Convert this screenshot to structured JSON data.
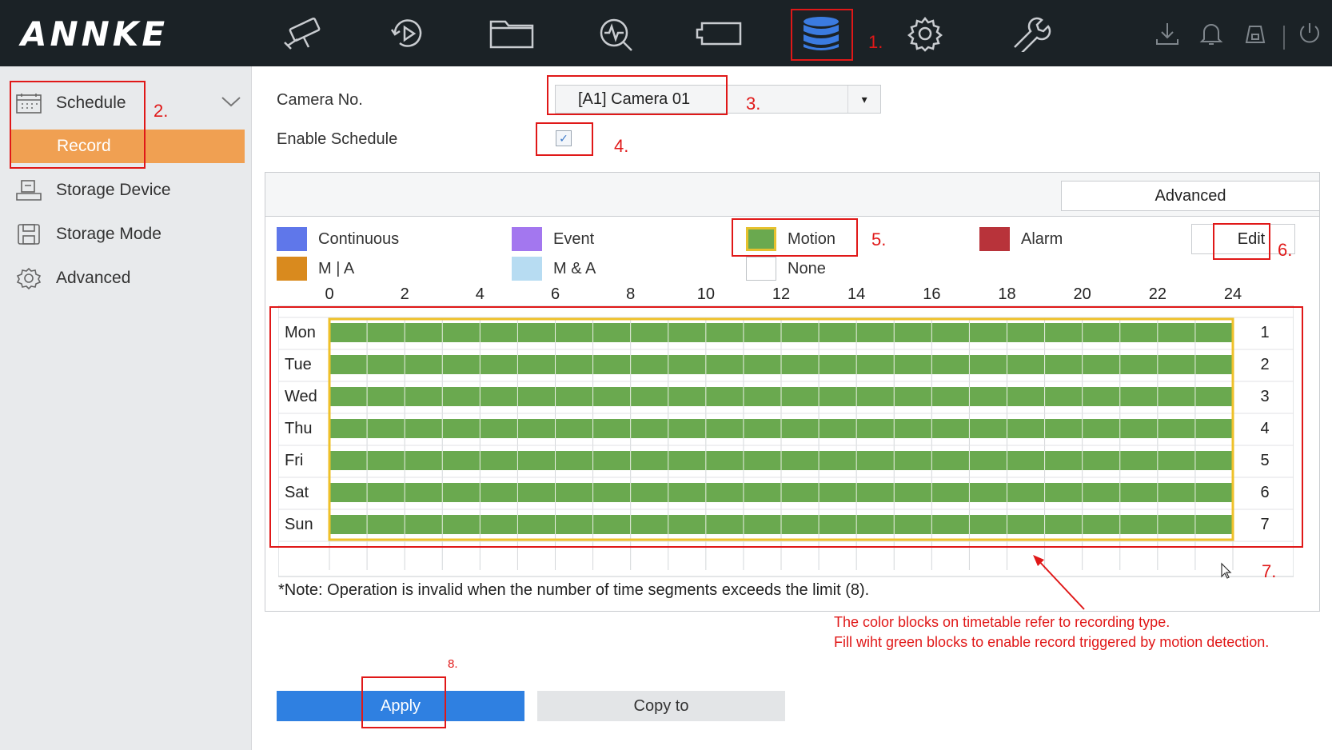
{
  "app": {
    "logo": "ANNKE"
  },
  "topnav": {
    "items": [
      {
        "name": "live-view-camera-icon"
      },
      {
        "name": "playback-icon"
      },
      {
        "name": "file-folder-icon"
      },
      {
        "name": "smart-analysis-icon"
      },
      {
        "name": "camera-management-icon"
      },
      {
        "name": "storage-database-icon",
        "active": true
      },
      {
        "name": "configuration-gear-icon"
      },
      {
        "name": "maintenance-wrench-icon"
      }
    ],
    "system_icons": [
      "download-icon",
      "bell-icon",
      "lock-icon",
      "power-icon"
    ],
    "active_color": "#3b7be0"
  },
  "sidebar": {
    "schedule": "Schedule",
    "record": "Record",
    "storage_device": "Storage Device",
    "storage_mode": "Storage Mode",
    "advanced": "Advanced"
  },
  "form": {
    "camera_label": "Camera No.",
    "camera_value": "[A1] Camera 01",
    "enable_label": "Enable Schedule",
    "enable_checked": true
  },
  "panel": {
    "advanced_button": "Advanced",
    "edit_button": "Edit"
  },
  "legend": [
    {
      "label": "Continuous",
      "color": "#5f77ea"
    },
    {
      "label": "Event",
      "color": "#a377ef"
    },
    {
      "label": "Motion",
      "color": "#6aa94f"
    },
    {
      "label": "Alarm",
      "color": "#b8333a"
    },
    {
      "label": "M | A",
      "color": "#d98a1e"
    },
    {
      "label": "M & A",
      "color": "#b7dcf2"
    },
    {
      "label": "None",
      "color": "#ffffff"
    }
  ],
  "timetable": {
    "hours": [
      "0",
      "2",
      "4",
      "6",
      "8",
      "10",
      "12",
      "14",
      "16",
      "18",
      "20",
      "22",
      "24"
    ],
    "days": [
      {
        "day": "Mon",
        "num": "1",
        "start": 0,
        "end": 24,
        "type": "Motion"
      },
      {
        "day": "Tue",
        "num": "2",
        "start": 0,
        "end": 24,
        "type": "Motion"
      },
      {
        "day": "Wed",
        "num": "3",
        "start": 0,
        "end": 24,
        "type": "Motion"
      },
      {
        "day": "Thu",
        "num": "4",
        "start": 0,
        "end": 24,
        "type": "Motion"
      },
      {
        "day": "Fri",
        "num": "5",
        "start": 0,
        "end": 24,
        "type": "Motion"
      },
      {
        "day": "Sat",
        "num": "6",
        "start": 0,
        "end": 24,
        "type": "Motion"
      },
      {
        "day": "Sun",
        "num": "7",
        "start": 0,
        "end": 24,
        "type": "Motion"
      }
    ],
    "note": "*Note: Operation is invalid when the number of time segments exceeds the limit (8)."
  },
  "buttons": {
    "apply": "Apply",
    "copy_to": "Copy to"
  },
  "annotations": {
    "a1": "1.",
    "a2": "2.",
    "a3": "3.",
    "a4": "4.",
    "a5": "5.",
    "a6": "6.",
    "a7": "7.",
    "a8": "8.",
    "callout_line1": "The color blocks on timetable refer to recording type.",
    "callout_line2": "Fill wiht green blocks to enable record triggered by motion detection.",
    "color": "#e01818"
  }
}
